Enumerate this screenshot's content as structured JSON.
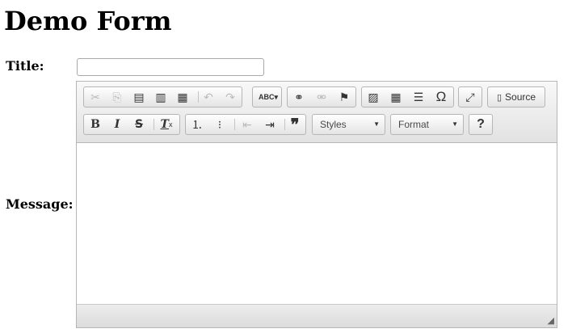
{
  "page": {
    "heading": "Demo Form"
  },
  "form": {
    "title_label": "Title:",
    "title_value": "",
    "message_label": "Message:"
  },
  "editor": {
    "toolbar": {
      "source_label": "Source",
      "styles_label": "Styles",
      "format_label": "Format",
      "help_glyph": "?"
    },
    "content_text": ""
  },
  "icons": {
    "cut": "✂",
    "copy": "⎘",
    "paste": "📋",
    "paste_text": "📋",
    "paste_word": "📋",
    "undo": "↶",
    "redo": "↷",
    "spellcheck": "ABC✓",
    "link": "🔗",
    "unlink": "⛓",
    "anchor": "⚑",
    "image": "🖼",
    "table": "▦",
    "hr": "☰",
    "special_char": "Ω",
    "maximize": "⛶",
    "bold": "B",
    "italic": "I",
    "strike": "S",
    "remove_format": "Tx",
    "numbered_list": "1≡",
    "bulleted_list": "•≡",
    "outdent": "⇤",
    "indent": "⇥",
    "blockquote": "❞",
    "dropdown": "▼",
    "resize": "◢"
  }
}
